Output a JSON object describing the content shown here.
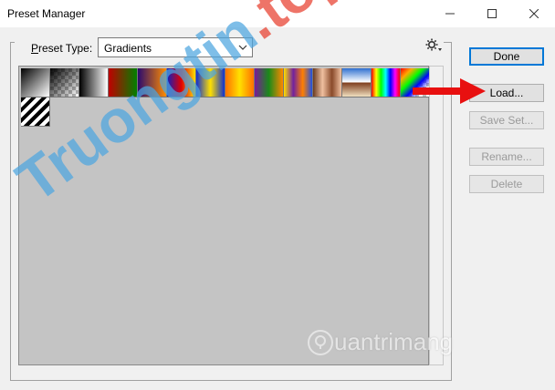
{
  "window": {
    "title": "Preset Manager"
  },
  "preset": {
    "label_prefix": "",
    "label_mnemonic": "P",
    "label_rest": "reset Type:",
    "value": "Gradients"
  },
  "buttons": {
    "done": "Done",
    "load": "Load...",
    "save": "Save Set...",
    "rename": "Rename...",
    "delete": "Delete"
  },
  "gradients": [
    {
      "name": "foreground-to-background",
      "css": "linear-gradient(135deg,#000 0%,#fff 100%)"
    },
    {
      "name": "foreground-to-transparent",
      "css": "linear-gradient(135deg,#000 0%,rgba(0,0,0,0) 100%)"
    },
    {
      "name": "black-white",
      "css": "linear-gradient(90deg,#000,#fff)"
    },
    {
      "name": "red-green",
      "css": "linear-gradient(90deg,#c00000,#008000)"
    },
    {
      "name": "violet-orange",
      "css": "linear-gradient(90deg,#2a0a6e,#ff8c00)"
    },
    {
      "name": "blue-red-yellow",
      "css": "linear-gradient(90deg,#1020c0,#e00000,#ffe000)"
    },
    {
      "name": "blue-yellow-blue",
      "css": "linear-gradient(90deg,#1030d0,#ffe000,#1030d0)"
    },
    {
      "name": "orange-yellow-orange",
      "css": "linear-gradient(90deg,#ff7000,#ffe000,#ff7000)"
    },
    {
      "name": "violet-green-orange",
      "css": "linear-gradient(90deg,#7a1a9a,#1a8a1a,#ff8800)"
    },
    {
      "name": "yellow-violet-orange-blue",
      "css": "linear-gradient(90deg,#ffe000,#7020a0,#ff8000,#2050e0)"
    },
    {
      "name": "copper",
      "css": "linear-gradient(90deg,#6a3a20,#f0c0a0,#8a4a2a,#f0c0a0)"
    },
    {
      "name": "chrome",
      "css": "linear-gradient(180deg,#3070d0,#ffffff 48%,#804020 52%,#f0e0c0)"
    },
    {
      "name": "spectrum",
      "css": "linear-gradient(90deg,#ff0000,#ffff00,#00ff00,#00ffff,#0000ff,#ff00ff,#ff0000)"
    },
    {
      "name": "transparent-rainbow",
      "css": "linear-gradient(135deg,#ff0000 0%,#ffaa00 20%,#00ff00 40%,#0000ff 60%,rgba(255,255,255,0) 80%)"
    },
    {
      "name": "transparent-stripes",
      "css": "repeating-linear-gradient(135deg,#000 0 4px,#fff 4px 8px)"
    }
  ],
  "watermarks": {
    "primary_left": "Truongtin",
    "primary_right": ".top",
    "secondary": "uantrimang"
  }
}
